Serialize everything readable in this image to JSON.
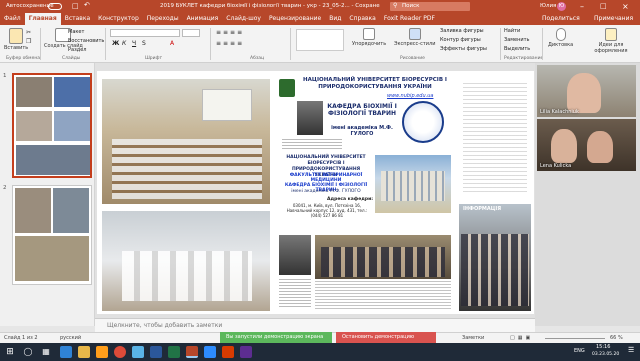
{
  "titlebar": {
    "autosave": "Автосохранение",
    "doc_title": "2019 БУКЛЕТ кафедри біохімії і фізіології тварин - укр - 23_05-2... - Сохранено в этот компьютер",
    "search_placeholder": "Поиск",
    "user_name": "Юлия",
    "user_initials": "Ю"
  },
  "tabs": [
    "Файл",
    "Главная",
    "Вставка",
    "Конструктор",
    "Переходы",
    "Анимация",
    "Слайд-шоу",
    "Рецензирование",
    "Вид",
    "Справка",
    "Foxit Reader PDF"
  ],
  "active_tab": "Главная",
  "share_label": "Поделиться",
  "comments_label": "Примечания",
  "ribbon": {
    "paste": "Вставить",
    "create_slide": "Создать слайд",
    "layout": "Макет",
    "restore": "Восстановить",
    "section": "Раздел",
    "arrange": "Упорядочить",
    "quick_styles": "Экспресс-стили",
    "shape_fill": "Заливка фигуры",
    "shape_outline": "Контур фигуры",
    "shape_effects": "Эффекты фигуры",
    "find": "Найти",
    "replace": "Заменить",
    "select": "Выделить",
    "dictation": "Диктовка",
    "designer": "Идеи для оформления",
    "groups": [
      "Буфер обмена",
      "Слайды",
      "Шрифт",
      "Абзац",
      "Рисование",
      "Редактирование",
      "Голос",
      "Конструктор"
    ]
  },
  "thumbnails": [
    {
      "num": "1"
    },
    {
      "num": "2"
    }
  ],
  "slide": {
    "university": "НАЦІОНАЛЬНИЙ УНІВЕРСИТЕТ БІОРЕСУРСІВ І ПРИРОДОКОРИСТУВАННЯ УКРАЇНИ",
    "website": "www.nubip.edu.ua",
    "department": "КАФЕДРА БІОХІМІЇ І ФІЗІОЛОГІЇ ТВАРИН",
    "named": "імені академіка М.Ф. ГУЛОГО",
    "uni2": "НАЦІОНАЛЬНИЙ УНІВЕРСИТЕТ БІОРЕСУРСІВ І ПРИРОДОКОРИСТУВАННЯ УКРАЇНИ",
    "faculty": "ФАКУЛЬТЕТ ВЕТЕРИНАРНОЇ МЕДИЦИНИ",
    "dept2": "КАФЕДРА БІОХІМІЇ І ФІЗІОЛОГІЇ ТВАРИН",
    "dept2_named": "імені академіка М.Ф. ГУЛОГО",
    "address_title": "Адреса кафедри:",
    "address": "03041, м. Київ, вул. Потєхіна 16, Навчальний корпус 12, ауд. 431, тел.: (044) 527 86 81",
    "info": "ІНФОРМАЦІЯ"
  },
  "notes_placeholder": "Щелкните, чтобы добавить заметки",
  "video": [
    {
      "name": "Lilia Kalachniuk"
    },
    {
      "name": "Lena Kulicka"
    }
  ],
  "status": {
    "slide_counter": "Слайд 1 из 2",
    "language": "русский",
    "sharing": "Вы запустили демонстрацию экрана",
    "stop_sharing": "Остановить демонстрацию",
    "notes_btn": "Заметки",
    "zoom": "66 %",
    "lang_tray": "ENG",
    "time": "15:16",
    "date": "03.23.05.20"
  },
  "colors": {
    "accent": "#b7472a",
    "share_green": "#5cb85c",
    "stop_red": "#d9534f"
  }
}
